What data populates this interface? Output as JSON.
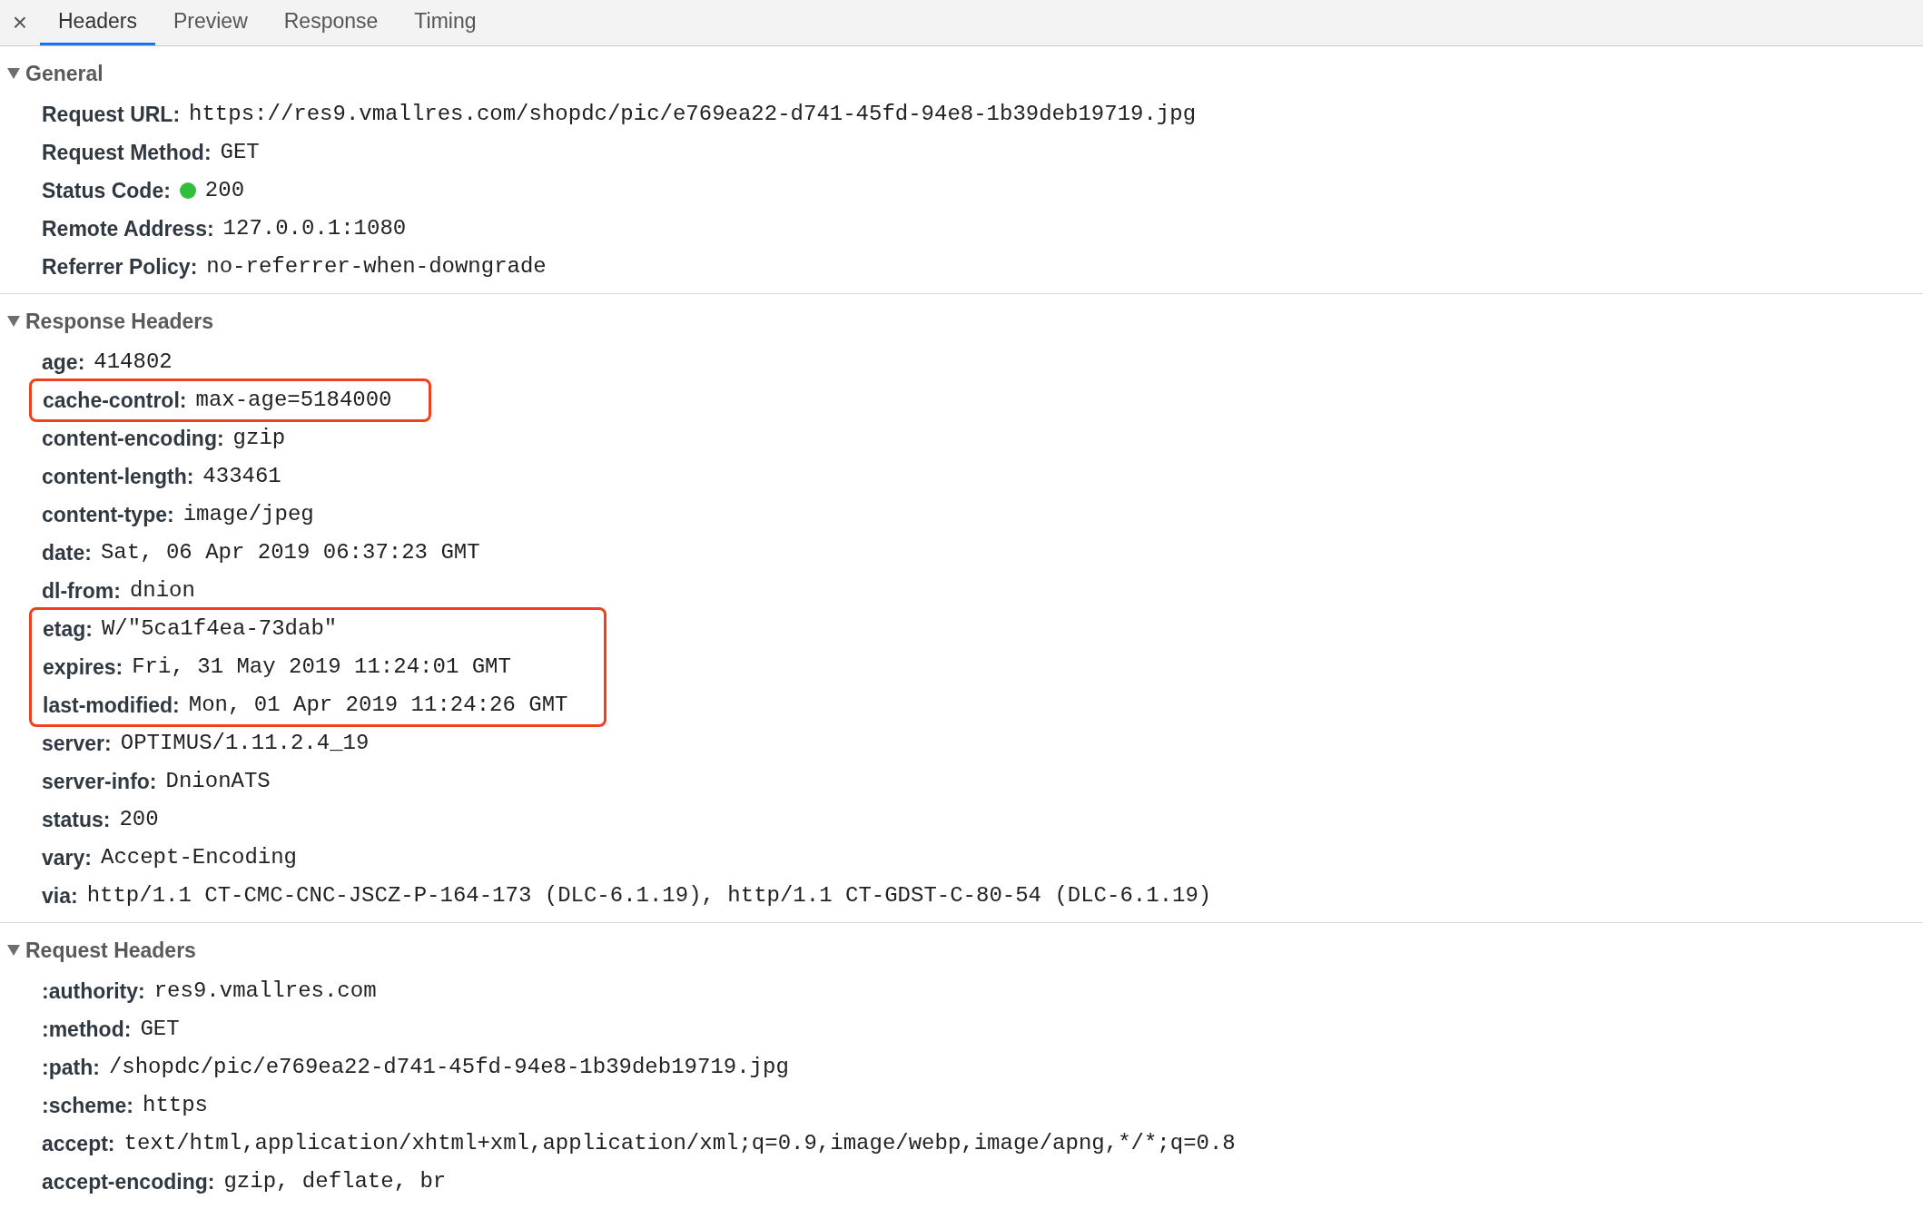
{
  "tabs": [
    {
      "label": "Headers",
      "selected": true
    },
    {
      "label": "Preview",
      "selected": false
    },
    {
      "label": "Response",
      "selected": false
    },
    {
      "label": "Timing",
      "selected": false
    }
  ],
  "close_symbol": "×",
  "sections": [
    {
      "title": "General",
      "expanded": true,
      "items": [
        {
          "name": "Request URL:",
          "value": "https://res9.vmallres.com/shopdc/pic/e769ea22-d741-45fd-94e8-1b39deb19719.jpg",
          "highlighted": false
        },
        {
          "name": "Request Method:",
          "value": "GET",
          "highlighted": false
        },
        {
          "name": "Status Code:",
          "value": "200",
          "highlighted": false,
          "color": "#2fbf3b"
        },
        {
          "name": "Remote Address:",
          "value": "127.0.0.1:1080",
          "highlighted": false
        },
        {
          "name": "Referrer Policy:",
          "value": "no-referrer-when-downgrade",
          "highlighted": false
        }
      ]
    },
    {
      "title": "Response Headers",
      "expanded": true,
      "items": [
        {
          "name": "age:",
          "value": "414802",
          "highlighted": false
        },
        {
          "name": "cache-control:",
          "value": "max-age=5184000",
          "highlighted": true
        },
        {
          "name": "content-encoding:",
          "value": "gzip",
          "highlighted": false
        },
        {
          "name": "content-length:",
          "value": "433461",
          "highlighted": false
        },
        {
          "name": "content-type:",
          "value": "image/jpeg",
          "highlighted": false
        },
        {
          "name": "date:",
          "value": "Sat, 06 Apr 2019 06:37:23 GMT",
          "highlighted": false
        },
        {
          "name": "dl-from:",
          "value": "dnion",
          "highlighted": false
        },
        {
          "name": "etag:",
          "value": "W/\"5ca1f4ea-73dab\"",
          "highlighted": true
        },
        {
          "name": "expires:",
          "value": "Fri, 31 May 2019 11:24:01 GMT",
          "highlighted": true
        },
        {
          "name": "last-modified:",
          "value": "Mon, 01 Apr 2019 11:24:26 GMT",
          "highlighted": true
        },
        {
          "name": "server:",
          "value": "OPTIMUS/1.11.2.4_19",
          "highlighted": false
        },
        {
          "name": "server-info:",
          "value": "DnionATS",
          "highlighted": false
        },
        {
          "name": "status:",
          "value": "200",
          "highlighted": false
        },
        {
          "name": "vary:",
          "value": "Accept-Encoding",
          "highlighted": false
        },
        {
          "name": "via:",
          "value": "http/1.1 CT-CMC-CNC-JSCZ-P-164-173 (DLC-6.1.19), http/1.1 CT-GDST-C-80-54 (DLC-6.1.19)",
          "highlighted": false
        }
      ]
    },
    {
      "title": "Request Headers",
      "expanded": true,
      "items": [
        {
          "name": ":authority:",
          "value": "res9.vmallres.com",
          "highlighted": false
        },
        {
          "name": ":method:",
          "value": "GET",
          "highlighted": false
        },
        {
          "name": ":path:",
          "value": "/shopdc/pic/e769ea22-d741-45fd-94e8-1b39deb19719.jpg",
          "highlighted": false
        },
        {
          "name": ":scheme:",
          "value": "https",
          "highlighted": false
        },
        {
          "name": "accept:",
          "value": "text/html,application/xhtml+xml,application/xml;q=0.9,image/webp,image/apng,*/*;q=0.8",
          "highlighted": false
        },
        {
          "name": "accept-encoding:",
          "value": "gzip, deflate, br",
          "highlighted": false
        }
      ]
    }
  ]
}
